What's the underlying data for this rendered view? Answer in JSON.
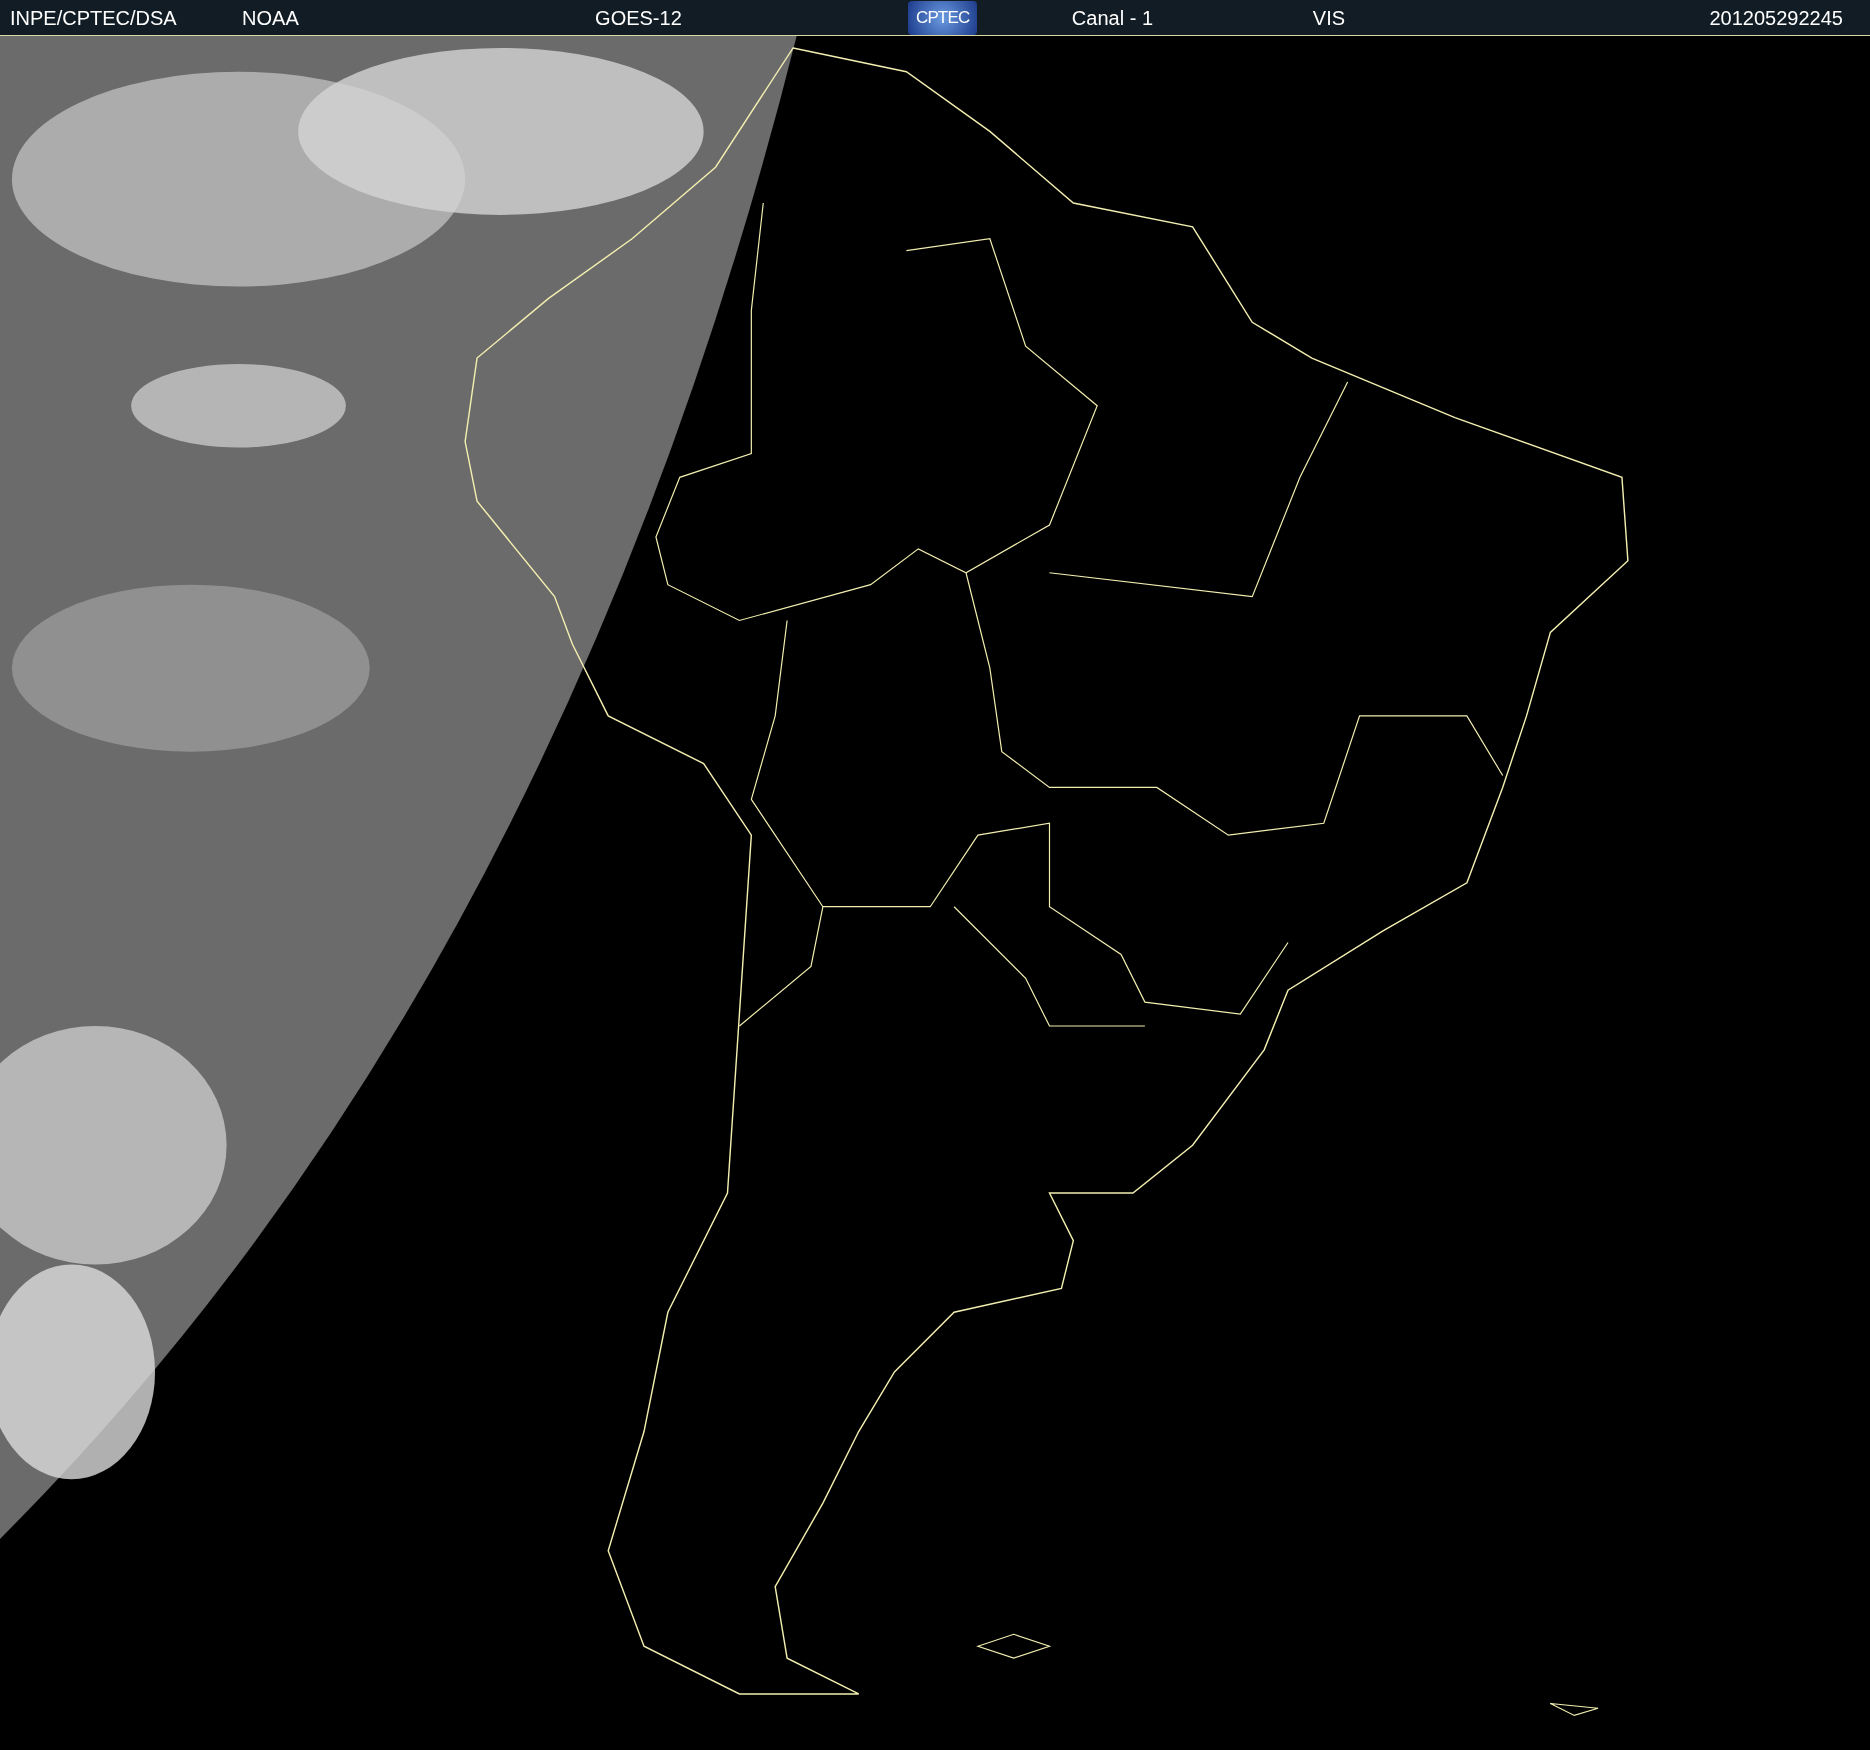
{
  "header": [
    {
      "kind": "text",
      "text": "INPE/CPTEC/DSA"
    },
    {
      "kind": "text",
      "text": "NOAA"
    },
    {
      "kind": "text",
      "text": "GOES-12"
    },
    {
      "kind": "logo",
      "text": "CPTEC"
    },
    {
      "kind": "text",
      "text": "Canal - 1"
    },
    {
      "kind": "text",
      "text": "VIS"
    },
    {
      "kind": "text",
      "text": "201205292245"
    }
  ]
}
